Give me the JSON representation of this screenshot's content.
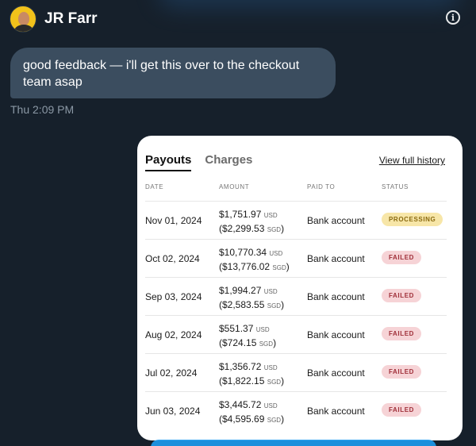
{
  "header": {
    "name": "JR Farr",
    "info_icon": "info-icon",
    "avatar_icon": "avatar"
  },
  "message": {
    "text": "good feedback — i'll get this over to the checkout team asap",
    "timestamp": "Thu 2:09 PM"
  },
  "card": {
    "tabs": [
      {
        "label": "Payouts",
        "active": true
      },
      {
        "label": "Charges",
        "active": false
      }
    ],
    "history_link": "View full history",
    "columns": [
      "DATE",
      "AMOUNT",
      "PAID TO",
      "STATUS"
    ],
    "rows": [
      {
        "date": "Nov 01, 2024",
        "usd": "$1,751.97",
        "usd_cur": "USD",
        "sgd": "($2,299.53",
        "sgd_cur": "SGD",
        "paid_to": "Bank account",
        "status": "PROCESSING"
      },
      {
        "date": "Oct 02, 2024",
        "usd": "$10,770.34",
        "usd_cur": "USD",
        "sgd": "($13,776.02",
        "sgd_cur": "SGD",
        "paid_to": "Bank account",
        "status": "FAILED"
      },
      {
        "date": "Sep 03, 2024",
        "usd": "$1,994.27",
        "usd_cur": "USD",
        "sgd": "($2,583.55",
        "sgd_cur": "SGD",
        "paid_to": "Bank account",
        "status": "FAILED"
      },
      {
        "date": "Aug 02, 2024",
        "usd": "$551.37",
        "usd_cur": "USD",
        "sgd": "($724.15",
        "sgd_cur": "SGD",
        "paid_to": "Bank account",
        "status": "FAILED"
      },
      {
        "date": "Jul 02, 2024",
        "usd": "$1,356.72",
        "usd_cur": "USD",
        "sgd": "($1,822.15",
        "sgd_cur": "SGD",
        "paid_to": "Bank account",
        "status": "FAILED"
      },
      {
        "date": "Jun 03, 2024",
        "usd": "$3,445.72",
        "usd_cur": "USD",
        "sgd": "($4,595.69",
        "sgd_cur": "SGD",
        "paid_to": "Bank account",
        "status": "FAILED"
      }
    ]
  },
  "colors": {
    "background": "#16202b",
    "bubble": "#3b4d5f",
    "processing_bg": "#f7e6a8",
    "failed_bg": "#f6d3d6"
  }
}
